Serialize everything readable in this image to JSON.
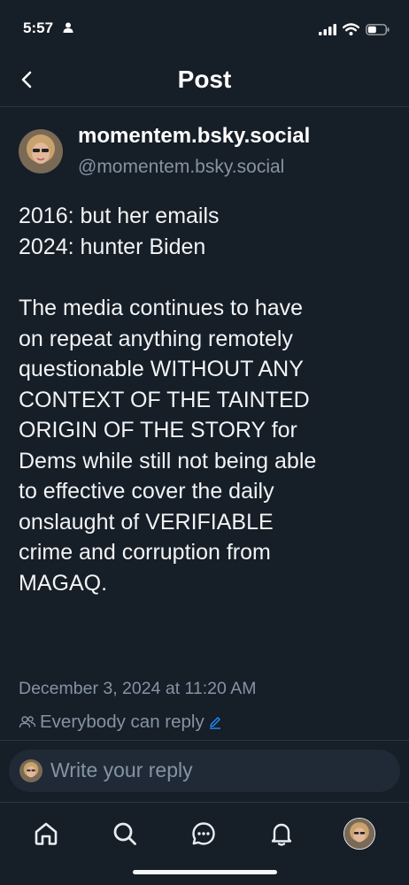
{
  "status_bar": {
    "time": "5:57"
  },
  "header": {
    "title": "Post"
  },
  "post": {
    "display_name": "momentem.bsky.social",
    "handle": "@momentem.bsky.social",
    "text_lines": [
      "2016: but her emails",
      "2024: hunter Biden",
      "",
      "The media continues to have",
      "on repeat anything remotely",
      "questionable WITHOUT ANY",
      "CONTEXT OF THE TAINTED",
      "ORIGIN OF THE STORY for",
      "Dems while still not being able",
      "to effective cover the daily",
      "onslaught of VERIFIABLE",
      "crime and corruption from",
      "MAGAQ."
    ],
    "timestamp": "December 3, 2024 at 11:20 AM",
    "reply_setting": "Everybody can reply"
  },
  "reply": {
    "placeholder": "Write your reply"
  },
  "tabs": [
    "home-icon",
    "search-icon",
    "chat-icon",
    "bell-icon",
    "profile-avatar"
  ],
  "colors": {
    "background": "#161e27",
    "muted_text": "#8593a4",
    "accent": "#208bfe"
  }
}
